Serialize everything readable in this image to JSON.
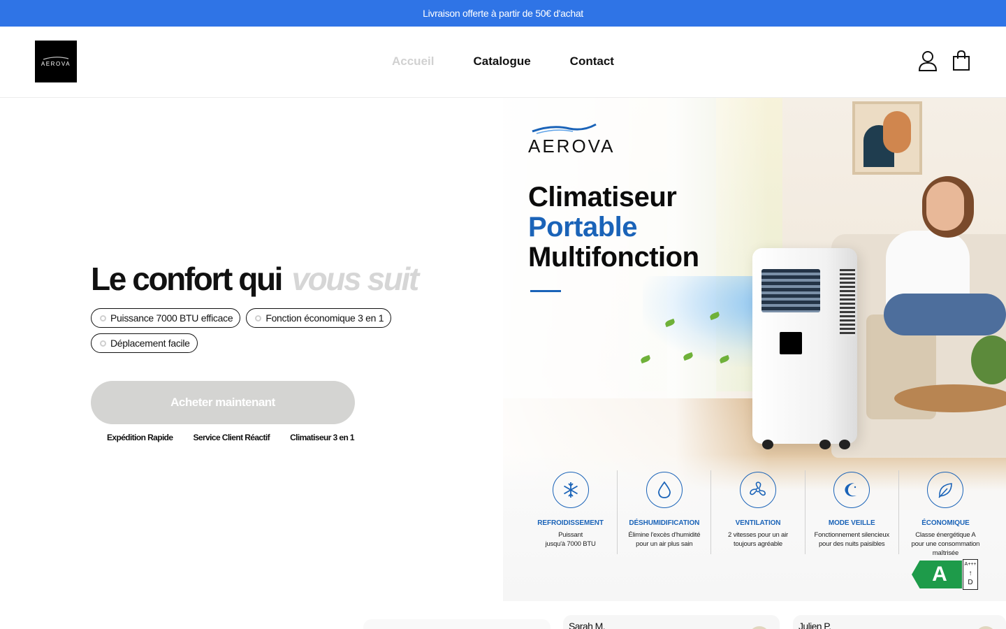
{
  "announcement": {
    "text": "Livraison offerte à partir de 50€ d'achat"
  },
  "header": {
    "logo_text": "AEROVA",
    "nav": [
      {
        "label": "Accueil",
        "active": true
      },
      {
        "label": "Catalogue",
        "active": false
      },
      {
        "label": "Contact",
        "active": false
      }
    ],
    "icons": [
      "account-icon",
      "cart-icon"
    ]
  },
  "hero": {
    "title": "Le confort qui",
    "title_accent": "vous suit",
    "pills": [
      "Puissance 7000 BTU efficace",
      "Fonction économique 3 en 1",
      "Déplacement facile"
    ],
    "cta_label": "Acheter maintenant",
    "features": [
      "Expédition Rapide",
      "Service Client Réactif",
      "Climatiseur 3 en 1"
    ]
  },
  "promo": {
    "brand": "AEROVA",
    "title_line1": "Climatiseur",
    "title_line2": "Portable",
    "title_line3": "Multifonction",
    "specs": [
      {
        "icon": "snowflake-icon",
        "title": "REFROIDISSEMENT",
        "desc_lines": [
          "Puissant",
          "jusqu'à 7000 BTU"
        ]
      },
      {
        "icon": "droplet-icon",
        "title": "DÉSHUMIDIFICATION",
        "desc_lines": [
          "Élimine l'excès d'humidité",
          "pour un air plus sain"
        ]
      },
      {
        "icon": "fan-icon",
        "title": "VENTILATION",
        "desc_lines": [
          "2 vitesses pour un air",
          "toujours agréable"
        ]
      },
      {
        "icon": "moon-icon",
        "title": "MODE VEILLE",
        "desc_lines": [
          "Fonctionnement silencieux",
          "pour des nuits paisibles"
        ]
      },
      {
        "icon": "leaf-icon",
        "title": "ÉCONOMIQUE",
        "desc_lines": [
          "Classe énergétique A",
          "pour une consommation",
          "maîtrisée"
        ]
      }
    ],
    "energy_class": "A",
    "energy_scale_top": "A+++",
    "energy_scale_bottom": "D"
  },
  "reviews": [
    {
      "name": "Sarah M."
    },
    {
      "name": "Julien P."
    }
  ],
  "colors": {
    "announcement_bg": "#2f74e6",
    "accent_blue": "#1a63b8",
    "cta_bg": "#d4d4d2",
    "energy_green": "#1e9b4a"
  }
}
